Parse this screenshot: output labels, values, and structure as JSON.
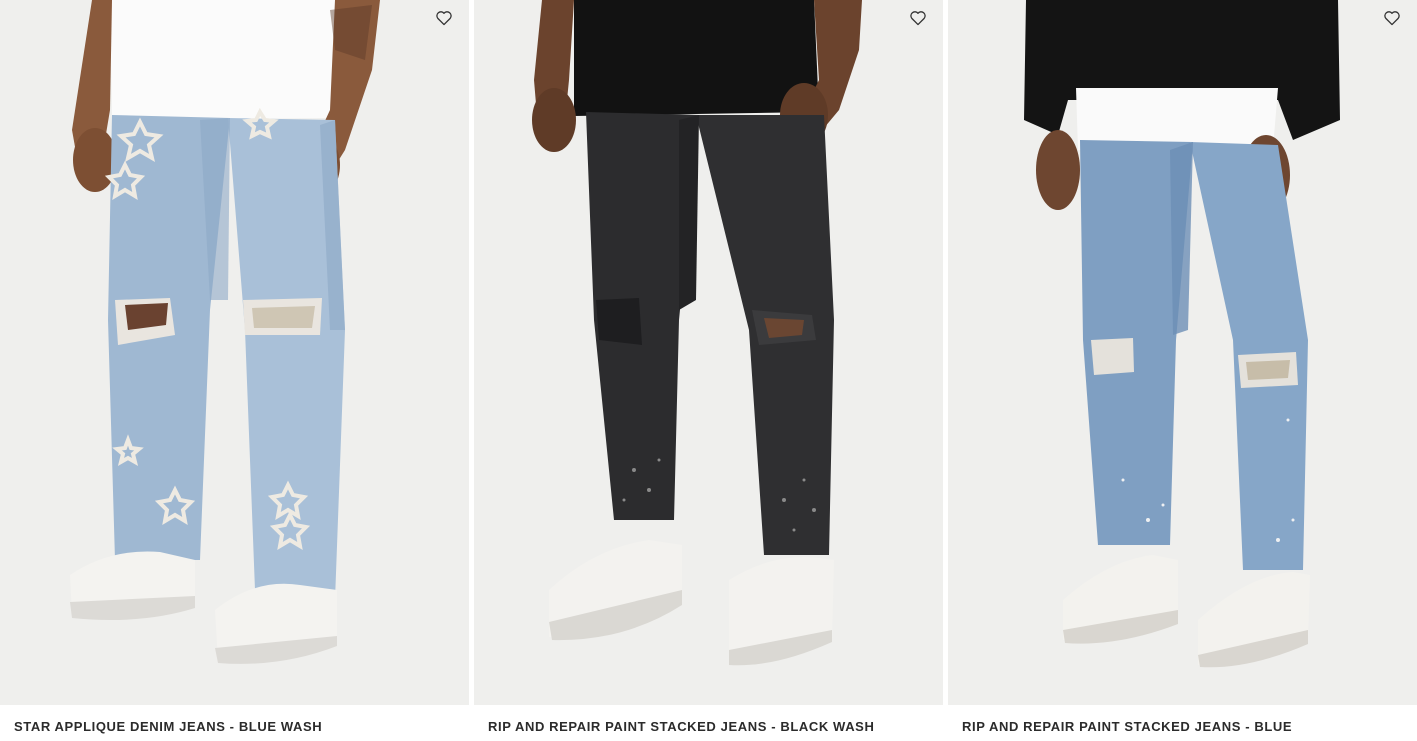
{
  "products": [
    {
      "name": "STAR APPLIQUE DENIM JEANS - BLUE WASH",
      "image_alt": "Model wearing light blue wash jeans with star appliques and ripped knees",
      "icon": "heart-icon"
    },
    {
      "name": "RIP AND REPAIR PAINT STACKED JEANS - BLACK WASH",
      "image_alt": "Model wearing black wash skinny jeans with ripped knees and paint splatter",
      "icon": "heart-icon"
    },
    {
      "name": "RIP AND REPAIR PAINT STACKED JEANS - BLUE",
      "image_alt": "Model wearing mid blue skinny jeans with ripped knees and paint splatter",
      "icon": "heart-icon"
    }
  ],
  "colors": {
    "photo_background": "#efefed",
    "title_text": "#2b2b2b",
    "icon_stroke": "#333333"
  }
}
